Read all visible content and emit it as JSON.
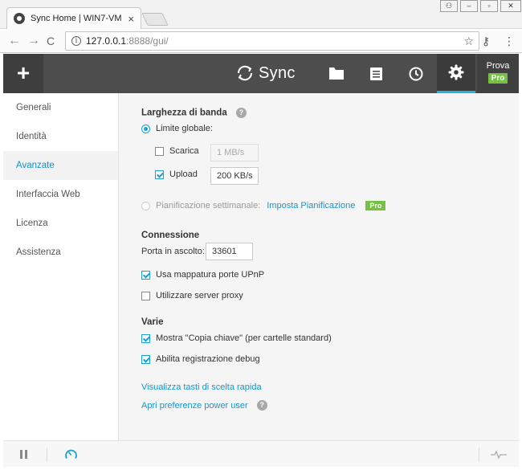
{
  "browser": {
    "tab_title": "Sync Home | WIN7-VM",
    "tab_close": "×",
    "url_host": "127.0.0.1",
    "url_path": ":8888/gui/",
    "info_glyph": "i",
    "back_glyph": "←",
    "forward_glyph": "→",
    "reload_glyph": "C",
    "star_glyph": "☆",
    "key_glyph": "⚷",
    "menu_glyph": "⋮"
  },
  "window_controls": {
    "user_glyph": "⚇",
    "minimize_glyph": "–",
    "restore_glyph": "▫",
    "close_glyph": "✕"
  },
  "header": {
    "add_label": "+",
    "app_name": "Sync",
    "plan_label": "Prova",
    "pro_label": "Pro",
    "accent": "#1fb4d9"
  },
  "sidebar": {
    "items": [
      {
        "label": "Generali"
      },
      {
        "label": "Identità"
      },
      {
        "label": "Avanzate"
      },
      {
        "label": "Interfaccia Web"
      },
      {
        "label": "Licenza"
      },
      {
        "label": "Assistenza"
      }
    ],
    "active": "Avanzate"
  },
  "bandwidth": {
    "title": "Larghezza di banda",
    "help": "?",
    "global_limit_label": "Limite globale:",
    "download_label": "Scarica",
    "download_value": "1 MB/s",
    "upload_label": "Upload",
    "upload_value": "200 KB/s",
    "schedule_label": "Pianificazione settimanale:",
    "schedule_link": "Imposta Pianificazione",
    "schedule_badge": "Pro"
  },
  "connection": {
    "title": "Connessione",
    "port_label": "Porta in ascolto:",
    "port_value": "33601",
    "upnp_label": "Usa mappatura porte UPnP",
    "proxy_label": "Utilizzare server proxy"
  },
  "misc": {
    "title": "Varie",
    "copy_key_label": "Mostra \"Copia chiave\" (per cartelle standard)",
    "debug_label": "Abilita registrazione debug"
  },
  "links": {
    "shortcuts": "Visualizza tasti di scelta rapida",
    "power_user": "Apri preferenze power user",
    "help": "?"
  }
}
